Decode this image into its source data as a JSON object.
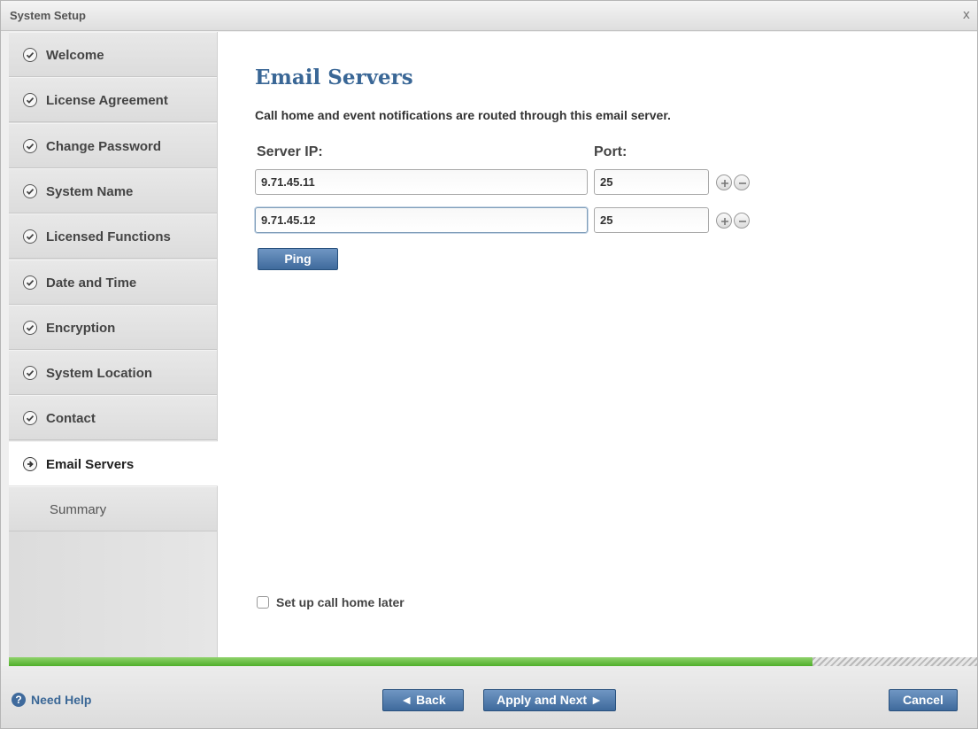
{
  "window": {
    "title": "System Setup",
    "close_glyph": "x"
  },
  "sidebar": {
    "steps": [
      {
        "label": "Welcome",
        "state": "done",
        "icon": "check-circle-icon"
      },
      {
        "label": "License Agreement",
        "state": "done",
        "icon": "check-circle-icon"
      },
      {
        "label": "Change Password",
        "state": "done",
        "icon": "check-circle-icon"
      },
      {
        "label": "System Name",
        "state": "done",
        "icon": "check-circle-icon"
      },
      {
        "label": "Licensed Functions",
        "state": "done",
        "icon": "check-circle-icon"
      },
      {
        "label": "Date and Time",
        "state": "done",
        "icon": "check-circle-icon"
      },
      {
        "label": "Encryption",
        "state": "done",
        "icon": "check-circle-icon"
      },
      {
        "label": "System Location",
        "state": "done",
        "icon": "check-circle-icon"
      },
      {
        "label": "Contact",
        "state": "done",
        "icon": "check-circle-icon"
      },
      {
        "label": "Email Servers",
        "state": "current",
        "icon": "arrow-circle-icon"
      },
      {
        "label": "Summary",
        "state": "pending"
      }
    ]
  },
  "main": {
    "title": "Email Servers",
    "description": "Call home and event notifications are routed through this email server.",
    "server_ip_label": "Server IP:",
    "port_label": "Port:",
    "servers": [
      {
        "ip": "9.71.45.11",
        "port": "25"
      },
      {
        "ip": "9.71.45.12",
        "port": "25"
      }
    ],
    "ping_label": "Ping",
    "call_home_later_label": "Set up call home later",
    "call_home_later_checked": false
  },
  "progress": {
    "fraction": 0.83,
    "fill_color": "#4fae2a"
  },
  "footer": {
    "help_label": "Need Help",
    "back_label": "◄ Back",
    "next_label": "Apply and Next ►",
    "cancel_label": "Cancel"
  },
  "colors": {
    "accent": "#3a6796",
    "button": "#3f6a9c"
  }
}
